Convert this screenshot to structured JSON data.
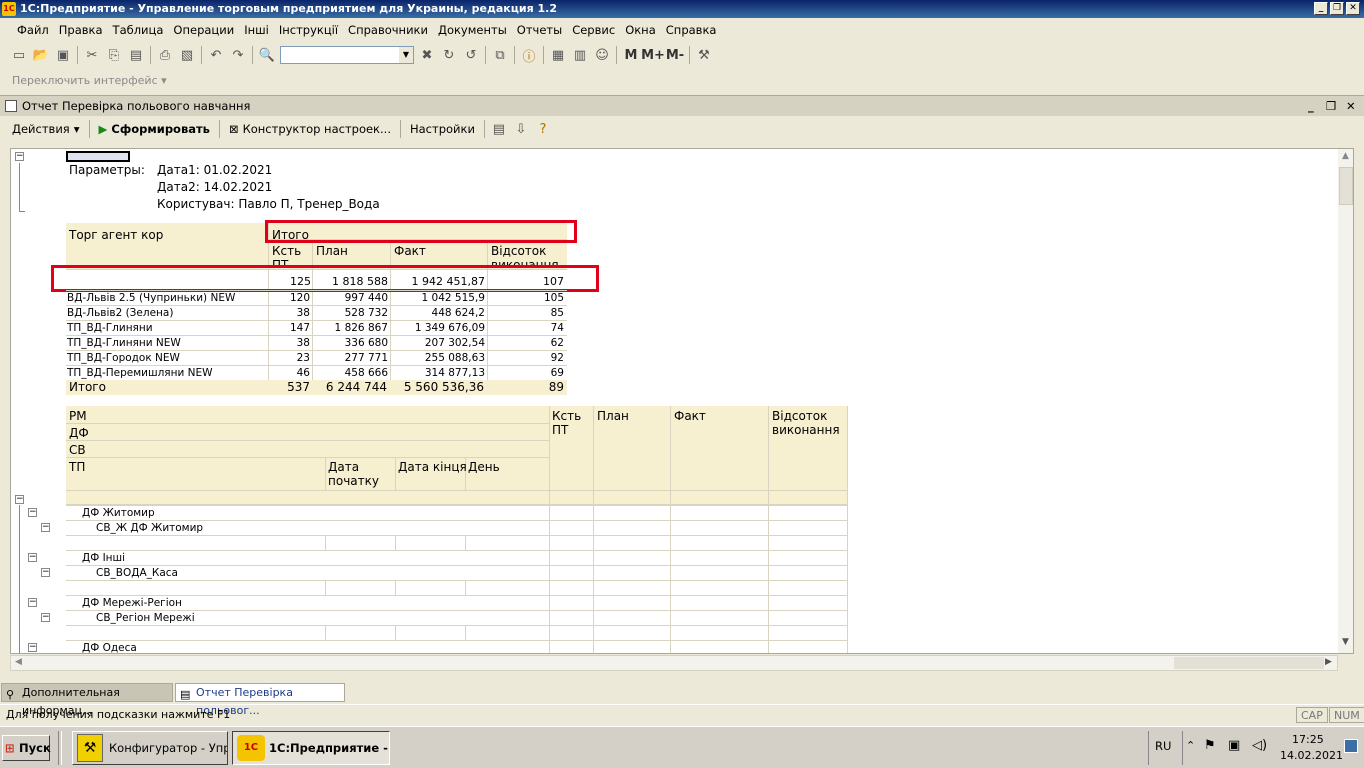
{
  "window": {
    "title": "1С:Предприятие - Управление торговым предприятием для Украины, редакция 1.2",
    "logo": "1С"
  },
  "menu": [
    "Файл",
    "Правка",
    "Таблица",
    "Операции",
    "Інші",
    "Інструкції",
    "Справочники",
    "Документы",
    "Отчеты",
    "Сервис",
    "Окна",
    "Справка"
  ],
  "toolbar": {
    "search_value": "",
    "icons": [
      "new-icon",
      "open-icon",
      "save-icon",
      "cut-icon",
      "copy-icon",
      "paste-icon",
      "print-icon",
      "preview-icon",
      "undo-icon",
      "redo-icon",
      "find-icon"
    ],
    "memory_buttons": [
      "M",
      "M+",
      "M-"
    ]
  },
  "interface_switch": "Переключить интерфейс",
  "doc": {
    "title": "Отчет  Перевірка польового навчання",
    "actions": "Действия",
    "generate": "Сформировать",
    "constructor": "Конструктор настроек...",
    "settings": "Настройки"
  },
  "report": {
    "params_label": "Параметры:",
    "param_lines": [
      "Дата1: 01.02.2021",
      "Дата2: 14.02.2021",
      "Користувач: Павло П, Тренер_Вода"
    ],
    "t1": {
      "group_header": "Торг агент кор",
      "total_header": "Итого",
      "columns": [
        "Ксть ПТ",
        "План",
        "Факт",
        "Відсоток виконання"
      ],
      "first_row": [
        "",
        "125",
        "1 818 588",
        "1 942 451,87",
        "107"
      ],
      "rows": [
        [
          "ВД-Львів 2.5 (Чуприньки) NEW",
          "120",
          "997 440",
          "1 042 515,9",
          "105"
        ],
        [
          "ВД-Львів2 (Зелена)",
          "38",
          "528 732",
          "448 624,2",
          "85"
        ],
        [
          "ТП_ВД-Глиняни",
          "147",
          "1 826 867",
          "1 349 676,09",
          "74"
        ],
        [
          "ТП_ВД-Глиняни NEW",
          "38",
          "336 680",
          "207 302,54",
          "62"
        ],
        [
          "ТП_ВД-Городок NEW",
          "23",
          "277 771",
          "255 088,63",
          "92"
        ],
        [
          "ТП_ВД-Перемишляни NEW",
          "46",
          "458 666",
          "314 877,13",
          "69"
        ]
      ],
      "total": [
        "Итого",
        "537",
        "6 244 744",
        "5 560 536,36",
        "89"
      ]
    },
    "t2": {
      "headers": [
        "РМ",
        "ДФ",
        "СВ",
        "ТП"
      ],
      "sub_headers": [
        "Дата початку",
        "Дата кінця",
        "День"
      ],
      "value_headers": [
        "Ксть ПТ",
        "План",
        "Факт",
        "Відсоток виконання"
      ],
      "rows": [
        {
          "level": 1,
          "text": "ДФ Житомир"
        },
        {
          "level": 2,
          "text": "СВ_Ж ДФ Житомир"
        },
        {
          "level": 3,
          "text": ""
        },
        {
          "level": 1,
          "text": "ДФ Інші"
        },
        {
          "level": 2,
          "text": "СВ_ВОДА_Каса"
        },
        {
          "level": 3,
          "text": ""
        },
        {
          "level": 1,
          "text": "ДФ Мережі-Регіон"
        },
        {
          "level": 2,
          "text": "СВ_Регіон Мережі"
        },
        {
          "level": 3,
          "text": ""
        },
        {
          "level": 1,
          "text": "ДФ Одеса"
        }
      ]
    }
  },
  "tabs": [
    "Дополнительная информац...",
    "Отчет  Перевірка польовог..."
  ],
  "status": {
    "hint": "Для получения подсказки нажмите F1",
    "cap": "CAP",
    "num": "NUM"
  },
  "taskbar": {
    "start": "Пуск",
    "buttons": [
      "Конфигуратор - Упр...",
      "1С:Предприятие - ..."
    ],
    "lang": "RU",
    "time": "17:25",
    "date": "14.02.2021"
  },
  "colors": {
    "highlight_red": "#e0001a",
    "header_yellow": "#f6efd0",
    "title_blue": "#0a246a"
  }
}
